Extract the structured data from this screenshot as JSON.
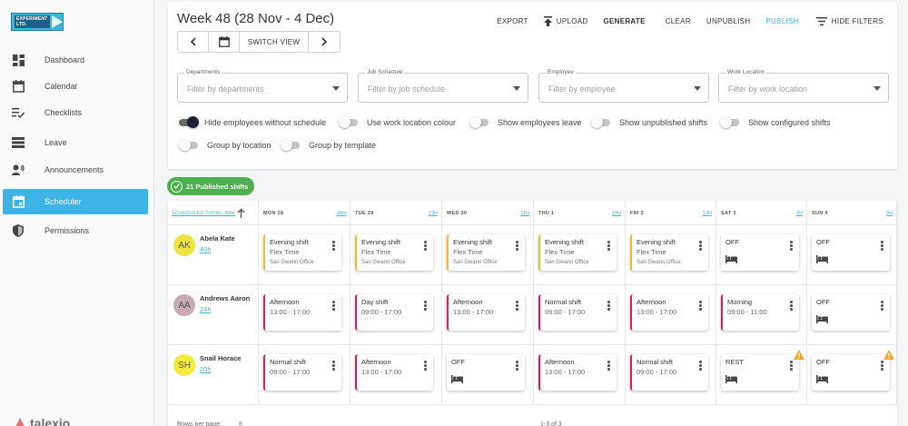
{
  "app": {
    "logo_text": "EXPERIMENT LTD.",
    "footer_brand": "talexio"
  },
  "sidebar": {
    "items": [
      {
        "label": "Dashboard",
        "icon": "dashboard-icon"
      },
      {
        "label": "Calendar",
        "icon": "calendar-icon"
      },
      {
        "label": "Checklists",
        "icon": "checklist-icon"
      },
      {
        "label": "Leave",
        "icon": "leave-icon"
      },
      {
        "label": "Announcements",
        "icon": "announcement-icon"
      },
      {
        "label": "Scheduler",
        "icon": "scheduler-icon",
        "active": true
      },
      {
        "label": "Permissions",
        "icon": "shield-icon"
      }
    ]
  },
  "header": {
    "title": "Week 48 (28 Nov - 4 Dec)",
    "switch_view": "SWITCH VIEW",
    "actions": {
      "export": "EXPORT",
      "upload": "UPLOAD",
      "generate": "GENERATE",
      "clear": "CLEAR",
      "unpublish": "UNPUBLISH",
      "publish": "PUBLISH",
      "hide_filters": "HIDE FILTERS"
    }
  },
  "filters": [
    {
      "label": "Departments",
      "placeholder": "Filter by departments"
    },
    {
      "label": "Job Schedule",
      "placeholder": "Filter by job schedule"
    },
    {
      "label": "Employee",
      "placeholder": "Filter by employee"
    },
    {
      "label": "Work Location",
      "placeholder": "Filter by work location"
    }
  ],
  "toggles": [
    {
      "label": "Hide employees without schedule",
      "on": true
    },
    {
      "label": "Use work location colour",
      "on": false
    },
    {
      "label": "Show employees leave",
      "on": false
    },
    {
      "label": "Show unpublished shifts",
      "on": false
    },
    {
      "label": "Show configured shifts",
      "on": false
    },
    {
      "label": "Group by location",
      "on": false
    },
    {
      "label": "Group by template",
      "on": false
    }
  ],
  "badge": {
    "text": "21 Published shifts",
    "color": "#4caf50"
  },
  "grid": {
    "total_label": "SCHEDULED TOTAL: 84H",
    "days": [
      {
        "name": "MON 28",
        "hours": "18H"
      },
      {
        "name": "TUE 29",
        "hours": "13H"
      },
      {
        "name": "WED 30",
        "hours": "11H"
      },
      {
        "name": "THU 1",
        "hours": "18H"
      },
      {
        "name": "FRI 2",
        "hours": "13H"
      },
      {
        "name": "SAT 3",
        "hours": "1H"
      },
      {
        "name": "SUN 4",
        "hours": "0H"
      }
    ],
    "employees": [
      {
        "initials": "AK",
        "name": "Abela Kate",
        "hours": "40h",
        "avatar_color": "#f0e442",
        "shifts": [
          {
            "name": "Evening shift",
            "time": "Flex Time",
            "location": "San Gwann Office",
            "color": "yellow"
          },
          {
            "name": "Evening shift",
            "time": "Flex Time",
            "location": "San Gwann Office",
            "color": "yellow"
          },
          {
            "name": "Evening shift",
            "time": "Flex Time",
            "location": "San Gwann Office",
            "color": "yellow"
          },
          {
            "name": "Evening shift",
            "time": "Flex Time",
            "location": "San Gwann Office",
            "color": "yellow"
          },
          {
            "name": "Evening shift",
            "time": "Flex Time",
            "location": "San Gwann Office",
            "color": "yellow"
          },
          {
            "name": "OFF",
            "off": true
          },
          {
            "name": "OFF",
            "off": true
          }
        ]
      },
      {
        "initials": "AA",
        "name": "Andrews Aaron",
        "hours": "24h",
        "avatar_color": "#c9a9b4",
        "shifts": [
          {
            "name": "Afternoon",
            "time": "13:00 - 17:00",
            "color": "pink"
          },
          {
            "name": "Day shift",
            "time": "09:00 - 17:00",
            "color": "pink"
          },
          {
            "name": "Afternoon",
            "time": "13:00 - 17:00",
            "color": "pink"
          },
          {
            "name": "Normal shift",
            "time": "09:00 - 17:00",
            "color": "pink"
          },
          {
            "name": "Afternoon",
            "time": "13:00 - 17:00",
            "color": "pink"
          },
          {
            "name": "Morning",
            "time": "09:00 - 11:00",
            "color": "pink"
          },
          {
            "name": "OFF",
            "off": true
          }
        ]
      },
      {
        "initials": "SH",
        "name": "Snail Horace",
        "hours": "20h",
        "avatar_color": "#f5e93b",
        "shifts": [
          {
            "name": "Normal shift",
            "time": "09:00 - 17:00",
            "color": "pink"
          },
          {
            "name": "Afternoon",
            "time": "13:00 - 17:00",
            "color": "pink"
          },
          {
            "name": "OFF",
            "off": true
          },
          {
            "name": "Afternoon",
            "time": "13:00 - 17:00",
            "color": "pink"
          },
          {
            "name": "Normal shift",
            "time": "09:00 - 17:00",
            "color": "pink"
          },
          {
            "name": "REST",
            "rest": true,
            "warn": true
          },
          {
            "name": "OFF",
            "off": true,
            "warn": true
          }
        ]
      }
    ],
    "footer": {
      "rows_per_page_label": "Rows per page:",
      "rows_per_page": "5",
      "range": "1-3 of 3"
    }
  }
}
